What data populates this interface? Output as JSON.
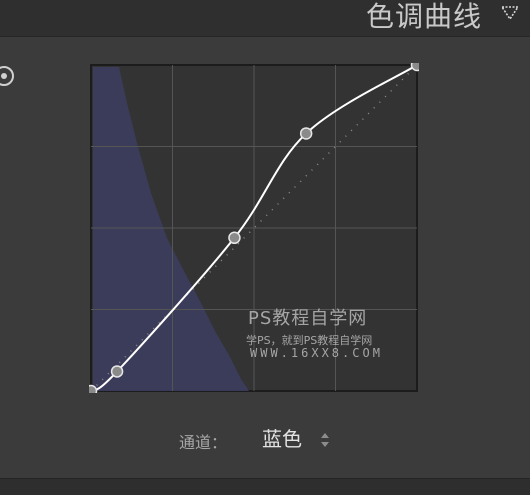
{
  "panel": {
    "title": "色调曲线",
    "collapse_icon": "triangle-down-icon",
    "target_adjust_icon": "target-adjust-icon"
  },
  "curve": {
    "channel": "blue",
    "histogram_color": "#3c3c5e",
    "curve_color": "#ffffff",
    "grid_color": "#555555",
    "control_points": [
      {
        "input": 0,
        "output": 0
      },
      {
        "input": 8,
        "output": 6
      },
      {
        "input": 44,
        "output": 47
      },
      {
        "input": 66,
        "output": 79
      },
      {
        "input": 100,
        "output": 100
      }
    ]
  },
  "channel": {
    "label": "通道：",
    "value": "蓝色"
  },
  "watermark": {
    "title": "PS教程自学网",
    "subtitle": "学PS，就到PS教程自学网",
    "url": "WWW.16XX8.COM"
  }
}
